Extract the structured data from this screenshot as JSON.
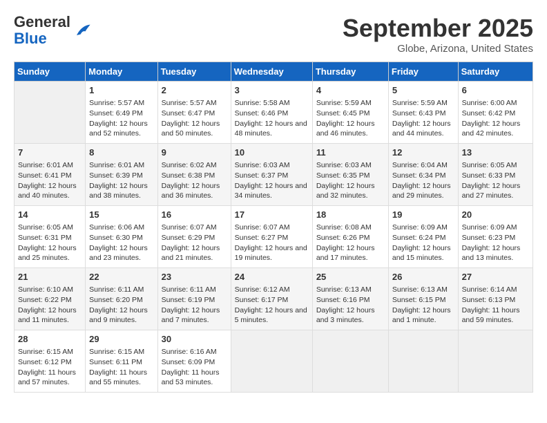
{
  "header": {
    "logo_general": "General",
    "logo_blue": "Blue",
    "month_title": "September 2025",
    "subtitle": "Globe, Arizona, United States"
  },
  "days_of_week": [
    "Sunday",
    "Monday",
    "Tuesday",
    "Wednesday",
    "Thursday",
    "Friday",
    "Saturday"
  ],
  "weeks": [
    [
      {
        "day": "",
        "empty": true
      },
      {
        "day": "1",
        "sunrise": "Sunrise: 5:57 AM",
        "sunset": "Sunset: 6:49 PM",
        "daylight": "Daylight: 12 hours and 52 minutes."
      },
      {
        "day": "2",
        "sunrise": "Sunrise: 5:57 AM",
        "sunset": "Sunset: 6:47 PM",
        "daylight": "Daylight: 12 hours and 50 minutes."
      },
      {
        "day": "3",
        "sunrise": "Sunrise: 5:58 AM",
        "sunset": "Sunset: 6:46 PM",
        "daylight": "Daylight: 12 hours and 48 minutes."
      },
      {
        "day": "4",
        "sunrise": "Sunrise: 5:59 AM",
        "sunset": "Sunset: 6:45 PM",
        "daylight": "Daylight: 12 hours and 46 minutes."
      },
      {
        "day": "5",
        "sunrise": "Sunrise: 5:59 AM",
        "sunset": "Sunset: 6:43 PM",
        "daylight": "Daylight: 12 hours and 44 minutes."
      },
      {
        "day": "6",
        "sunrise": "Sunrise: 6:00 AM",
        "sunset": "Sunset: 6:42 PM",
        "daylight": "Daylight: 12 hours and 42 minutes."
      }
    ],
    [
      {
        "day": "7",
        "sunrise": "Sunrise: 6:01 AM",
        "sunset": "Sunset: 6:41 PM",
        "daylight": "Daylight: 12 hours and 40 minutes."
      },
      {
        "day": "8",
        "sunrise": "Sunrise: 6:01 AM",
        "sunset": "Sunset: 6:39 PM",
        "daylight": "Daylight: 12 hours and 38 minutes."
      },
      {
        "day": "9",
        "sunrise": "Sunrise: 6:02 AM",
        "sunset": "Sunset: 6:38 PM",
        "daylight": "Daylight: 12 hours and 36 minutes."
      },
      {
        "day": "10",
        "sunrise": "Sunrise: 6:03 AM",
        "sunset": "Sunset: 6:37 PM",
        "daylight": "Daylight: 12 hours and 34 minutes."
      },
      {
        "day": "11",
        "sunrise": "Sunrise: 6:03 AM",
        "sunset": "Sunset: 6:35 PM",
        "daylight": "Daylight: 12 hours and 32 minutes."
      },
      {
        "day": "12",
        "sunrise": "Sunrise: 6:04 AM",
        "sunset": "Sunset: 6:34 PM",
        "daylight": "Daylight: 12 hours and 29 minutes."
      },
      {
        "day": "13",
        "sunrise": "Sunrise: 6:05 AM",
        "sunset": "Sunset: 6:33 PM",
        "daylight": "Daylight: 12 hours and 27 minutes."
      }
    ],
    [
      {
        "day": "14",
        "sunrise": "Sunrise: 6:05 AM",
        "sunset": "Sunset: 6:31 PM",
        "daylight": "Daylight: 12 hours and 25 minutes."
      },
      {
        "day": "15",
        "sunrise": "Sunrise: 6:06 AM",
        "sunset": "Sunset: 6:30 PM",
        "daylight": "Daylight: 12 hours and 23 minutes."
      },
      {
        "day": "16",
        "sunrise": "Sunrise: 6:07 AM",
        "sunset": "Sunset: 6:29 PM",
        "daylight": "Daylight: 12 hours and 21 minutes."
      },
      {
        "day": "17",
        "sunrise": "Sunrise: 6:07 AM",
        "sunset": "Sunset: 6:27 PM",
        "daylight": "Daylight: 12 hours and 19 minutes."
      },
      {
        "day": "18",
        "sunrise": "Sunrise: 6:08 AM",
        "sunset": "Sunset: 6:26 PM",
        "daylight": "Daylight: 12 hours and 17 minutes."
      },
      {
        "day": "19",
        "sunrise": "Sunrise: 6:09 AM",
        "sunset": "Sunset: 6:24 PM",
        "daylight": "Daylight: 12 hours and 15 minutes."
      },
      {
        "day": "20",
        "sunrise": "Sunrise: 6:09 AM",
        "sunset": "Sunset: 6:23 PM",
        "daylight": "Daylight: 12 hours and 13 minutes."
      }
    ],
    [
      {
        "day": "21",
        "sunrise": "Sunrise: 6:10 AM",
        "sunset": "Sunset: 6:22 PM",
        "daylight": "Daylight: 12 hours and 11 minutes."
      },
      {
        "day": "22",
        "sunrise": "Sunrise: 6:11 AM",
        "sunset": "Sunset: 6:20 PM",
        "daylight": "Daylight: 12 hours and 9 minutes."
      },
      {
        "day": "23",
        "sunrise": "Sunrise: 6:11 AM",
        "sunset": "Sunset: 6:19 PM",
        "daylight": "Daylight: 12 hours and 7 minutes."
      },
      {
        "day": "24",
        "sunrise": "Sunrise: 6:12 AM",
        "sunset": "Sunset: 6:17 PM",
        "daylight": "Daylight: 12 hours and 5 minutes."
      },
      {
        "day": "25",
        "sunrise": "Sunrise: 6:13 AM",
        "sunset": "Sunset: 6:16 PM",
        "daylight": "Daylight: 12 hours and 3 minutes."
      },
      {
        "day": "26",
        "sunrise": "Sunrise: 6:13 AM",
        "sunset": "Sunset: 6:15 PM",
        "daylight": "Daylight: 12 hours and 1 minute."
      },
      {
        "day": "27",
        "sunrise": "Sunrise: 6:14 AM",
        "sunset": "Sunset: 6:13 PM",
        "daylight": "Daylight: 11 hours and 59 minutes."
      }
    ],
    [
      {
        "day": "28",
        "sunrise": "Sunrise: 6:15 AM",
        "sunset": "Sunset: 6:12 PM",
        "daylight": "Daylight: 11 hours and 57 minutes."
      },
      {
        "day": "29",
        "sunrise": "Sunrise: 6:15 AM",
        "sunset": "Sunset: 6:11 PM",
        "daylight": "Daylight: 11 hours and 55 minutes."
      },
      {
        "day": "30",
        "sunrise": "Sunrise: 6:16 AM",
        "sunset": "Sunset: 6:09 PM",
        "daylight": "Daylight: 11 hours and 53 minutes."
      },
      {
        "day": "",
        "empty": true
      },
      {
        "day": "",
        "empty": true
      },
      {
        "day": "",
        "empty": true
      },
      {
        "day": "",
        "empty": true
      }
    ]
  ]
}
